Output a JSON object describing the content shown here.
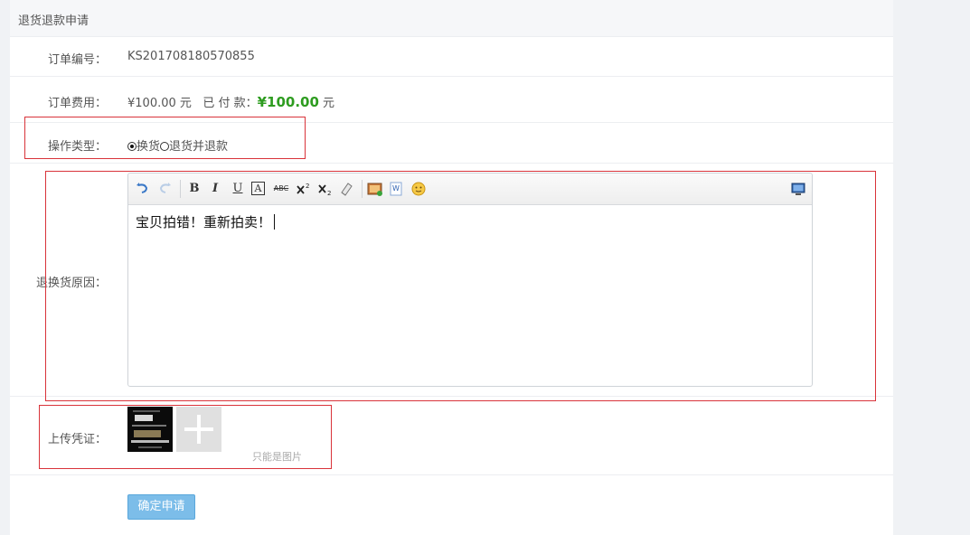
{
  "page": {
    "title": "退货退款申请"
  },
  "order": {
    "number_label": "订单编号：",
    "number_value": "KS201708180570855",
    "fee_label": "订单费用：",
    "fee_value": "¥100.00 元",
    "paid_label": "已 付 款：",
    "paid_value": "¥100.00",
    "paid_unit": "元"
  },
  "operation": {
    "label": "操作类型：",
    "options": [
      {
        "label": "换货",
        "selected": true
      },
      {
        "label": "退货并退款",
        "selected": false
      }
    ]
  },
  "reason": {
    "label": "退换货原因：",
    "content": "宝贝拍错！重新拍卖！",
    "toolbar": {
      "bold": "B",
      "italic": "I",
      "underline": "U",
      "font_color": "A",
      "strike": "ABC"
    }
  },
  "upload": {
    "label": "上传凭证：",
    "hint": "只能是图片"
  },
  "submit": {
    "label": "确定申请"
  },
  "colors": {
    "accent": "#2e9c20",
    "button": "#7cbde9",
    "highlight_box": "#d9333a"
  }
}
